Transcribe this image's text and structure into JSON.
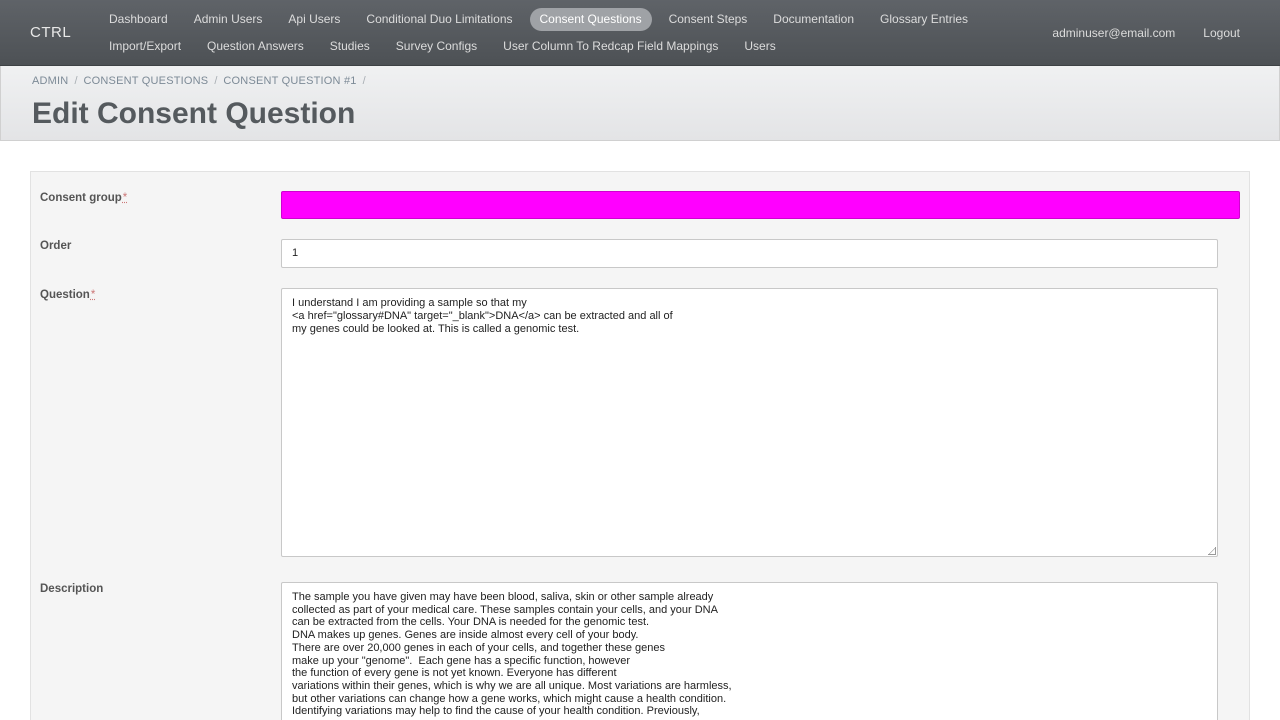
{
  "nav": {
    "brand": "CTRL",
    "row1": [
      "Dashboard",
      "Admin Users",
      "Api Users",
      "Conditional Duo Limitations",
      "Consent Questions",
      "Consent Steps",
      "Documentation",
      "Glossary Entries"
    ],
    "row2": [
      "Import/Export",
      "Question Answers",
      "Studies",
      "Survey Configs",
      "User Column To Redcap Field Mappings",
      "Users"
    ],
    "active": "Consent Questions",
    "user_email": "adminuser@email.com",
    "logout": "Logout"
  },
  "breadcrumb": [
    "ADMIN",
    "CONSENT QUESTIONS",
    "CONSENT QUESTION #1"
  ],
  "page_title": "Edit Consent Question",
  "form": {
    "consent_group": {
      "label": "Consent group",
      "required": "*",
      "color": "#ff00ff"
    },
    "order": {
      "label": "Order",
      "value": "1"
    },
    "question": {
      "label": "Question",
      "required": "*",
      "value": "I understand I am providing a sample so that my\n<a href=\"glossary#DNA\" target=\"_blank\">DNA</a> can be extracted and all of\nmy genes could be looked at. This is called a genomic test."
    },
    "description": {
      "label": "Description",
      "value": "The sample you have given may have been blood, saliva, skin or other sample already\ncollected as part of your medical care. These samples contain your cells, and your DNA\ncan be extracted from the cells. Your DNA is needed for the genomic test.\nDNA makes up genes. Genes are inside almost every cell of your body.\nThere are over 20,000 genes in each of your cells, and together these genes\nmake up your \"genome\".  Each gene has a specific function, however\nthe function of every gene is not yet known. Everyone has different\nvariations within their genes, which is why we are all unique. Most variations are harmless,\nbut other variations can change how a gene works, which might cause a health condition.\nIdentifying variations may help to find the cause of your health condition. Previously,"
    }
  }
}
